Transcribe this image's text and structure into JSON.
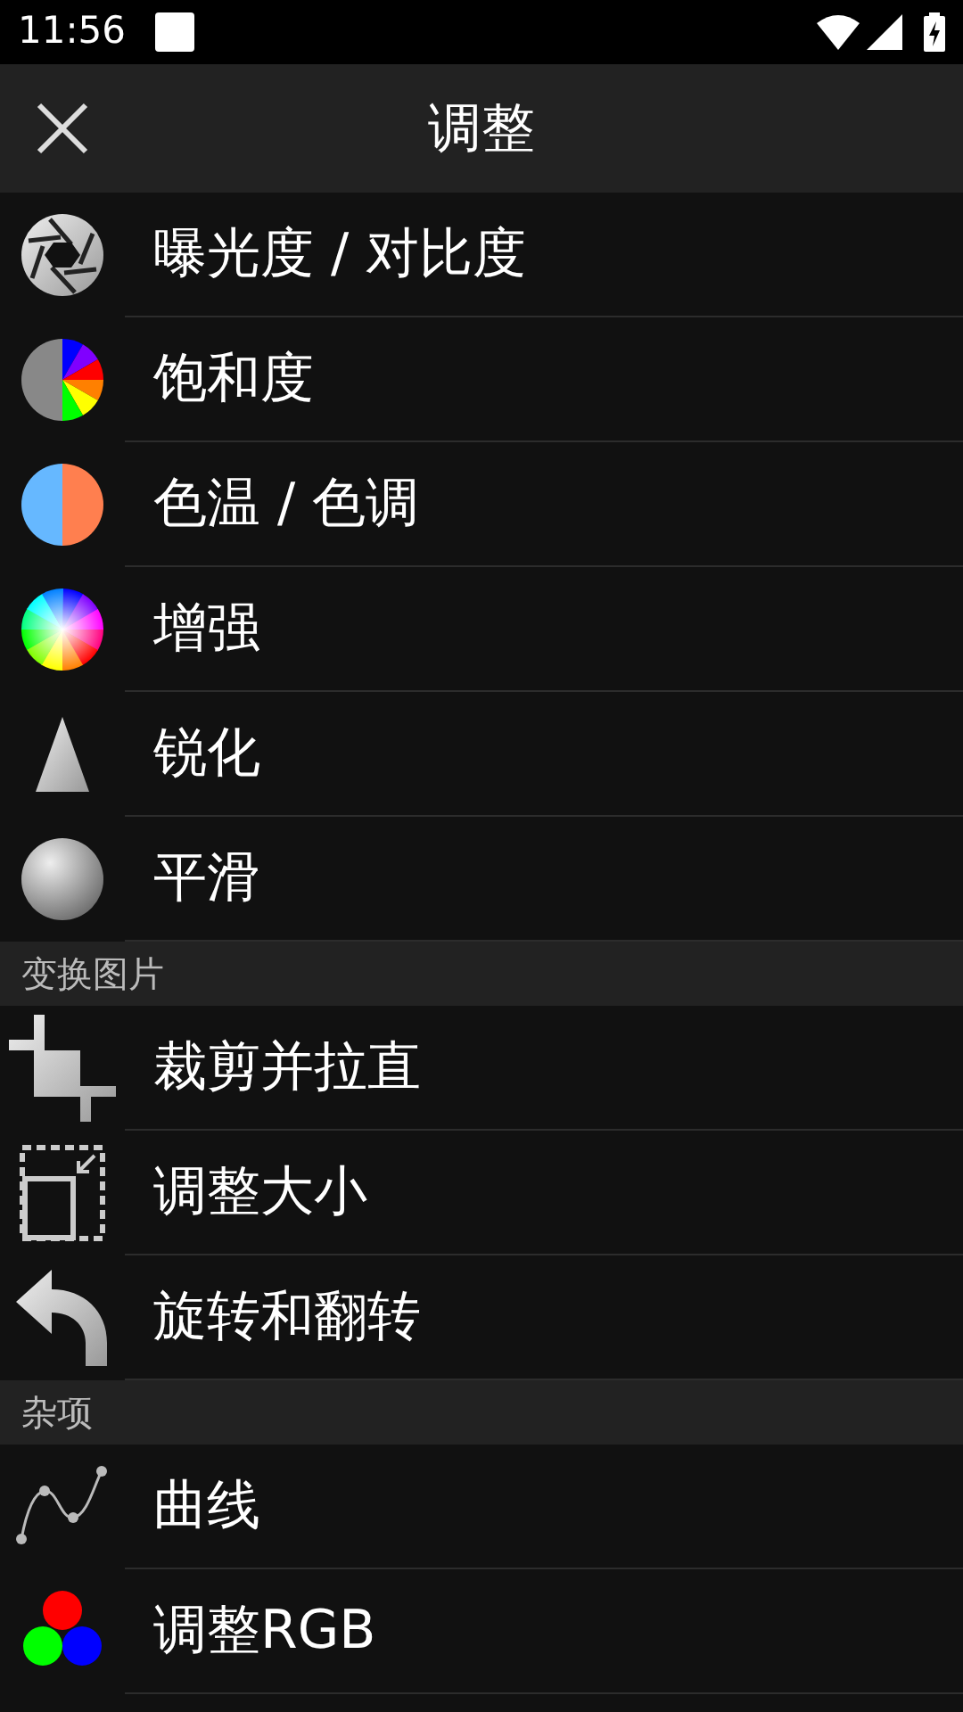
{
  "status_bar": {
    "time": "11:56"
  },
  "header": {
    "title": "调整"
  },
  "sections": [
    {
      "items": [
        {
          "label": "曝光度 / 对比度",
          "kind": "aperture"
        },
        {
          "label": "饱和度",
          "kind": "saturation"
        },
        {
          "label": "色温 / 色调",
          "kind": "temperature"
        },
        {
          "label": "增强",
          "kind": "enhance"
        },
        {
          "label": "锐化",
          "kind": "sharpen"
        },
        {
          "label": "平滑",
          "kind": "smooth"
        }
      ]
    },
    {
      "title": "变换图片",
      "items": [
        {
          "label": "裁剪并拉直",
          "kind": "crop"
        },
        {
          "label": "调整大小",
          "kind": "resize"
        },
        {
          "label": "旋转和翻转",
          "kind": "rotate"
        }
      ]
    },
    {
      "title": "杂项",
      "items": [
        {
          "label": "曲线",
          "kind": "curves"
        },
        {
          "label": "调整RGB",
          "kind": "rgb"
        }
      ]
    }
  ]
}
